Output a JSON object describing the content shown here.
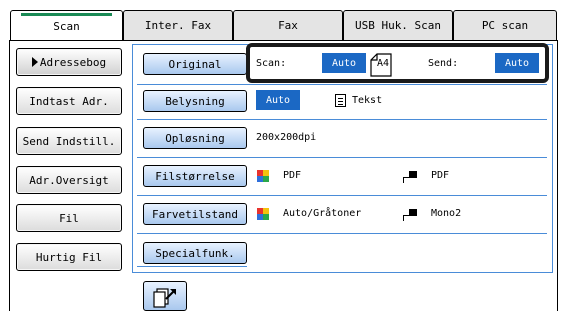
{
  "tabs": [
    {
      "label": "Scan"
    },
    {
      "label": "Inter. Fax"
    },
    {
      "label": "Fax"
    },
    {
      "label": "USB Huk. Scan"
    },
    {
      "label": "PC scan"
    }
  ],
  "sidebar": {
    "items": [
      {
        "label": "Adressebog"
      },
      {
        "label": "Indtast Adr."
      },
      {
        "label": "Send Indstill."
      },
      {
        "label": "Adr.Oversigt"
      },
      {
        "label": "Fil"
      },
      {
        "label": "Hurtig Fil"
      }
    ]
  },
  "original": {
    "button": "Original",
    "scan_label": "Scan:",
    "scan_value": "Auto",
    "size": "A4",
    "send_label": "Send:",
    "send_value": "Auto"
  },
  "exposure": {
    "button": "Belysning",
    "value": "Auto",
    "mode": "Tekst"
  },
  "resolution": {
    "button": "Opløsning",
    "value": "200x200dpi"
  },
  "file_format": {
    "button": "Filstørrelse",
    "color_value": "PDF",
    "mono_value": "PDF"
  },
  "color_mode": {
    "button": "Farvetilstand",
    "color_value": "Auto/Gråtoner",
    "mono_value": "Mono2"
  },
  "special": {
    "button": "Specialfunk."
  },
  "icons": {
    "color_mode": "color-icon",
    "mono_mode": "mono-icon",
    "exposure_mode": "document-icon",
    "paper_size": "paper-a4-icon",
    "bottom_action": "scan-to-arrow-icon"
  },
  "colors": {
    "accent_blue": "#1b68c4",
    "tab_indicator": "#1a8a55",
    "button_blue": "#a9c8ee",
    "frame_dark": "#1a1a1a"
  }
}
